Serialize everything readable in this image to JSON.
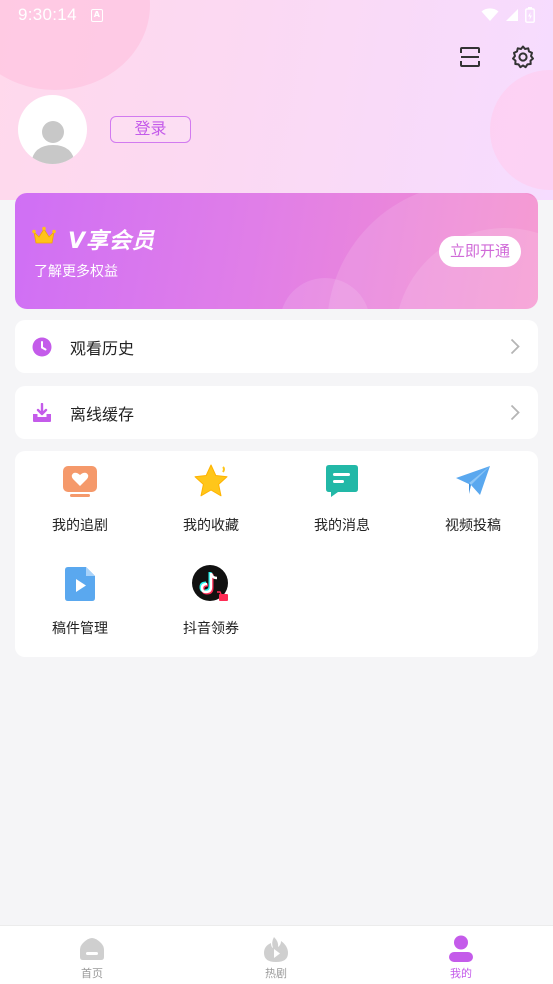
{
  "status_bar": {
    "time": "9:30:14",
    "app_badge": "A"
  },
  "header": {
    "login_label": "登录"
  },
  "vip": {
    "title": "V享会员",
    "subtitle": "了解更多权益",
    "open_label": "立即开通"
  },
  "menu": [
    {
      "label": "观看历史",
      "icon": "clock-icon"
    },
    {
      "label": "离线缓存",
      "icon": "download-icon"
    }
  ],
  "grid": [
    {
      "label": "我的追剧",
      "icon": "tv-heart-icon"
    },
    {
      "label": "我的收藏",
      "icon": "star-icon"
    },
    {
      "label": "我的消息",
      "icon": "message-icon"
    },
    {
      "label": "视频投稿",
      "icon": "paper-plane-icon"
    },
    {
      "label": "稿件管理",
      "icon": "video-file-icon"
    },
    {
      "label": "抖音领券",
      "icon": "douyin-icon"
    }
  ],
  "nav": [
    {
      "label": "首页",
      "icon": "home-icon"
    },
    {
      "label": "热剧",
      "icon": "flame-icon"
    },
    {
      "label": "我的",
      "icon": "user-icon",
      "active": true
    }
  ],
  "colors": {
    "accent": "#c45bea",
    "vip_gradient_start": "#cf6ff5",
    "vip_gradient_end": "#f58fcd"
  }
}
